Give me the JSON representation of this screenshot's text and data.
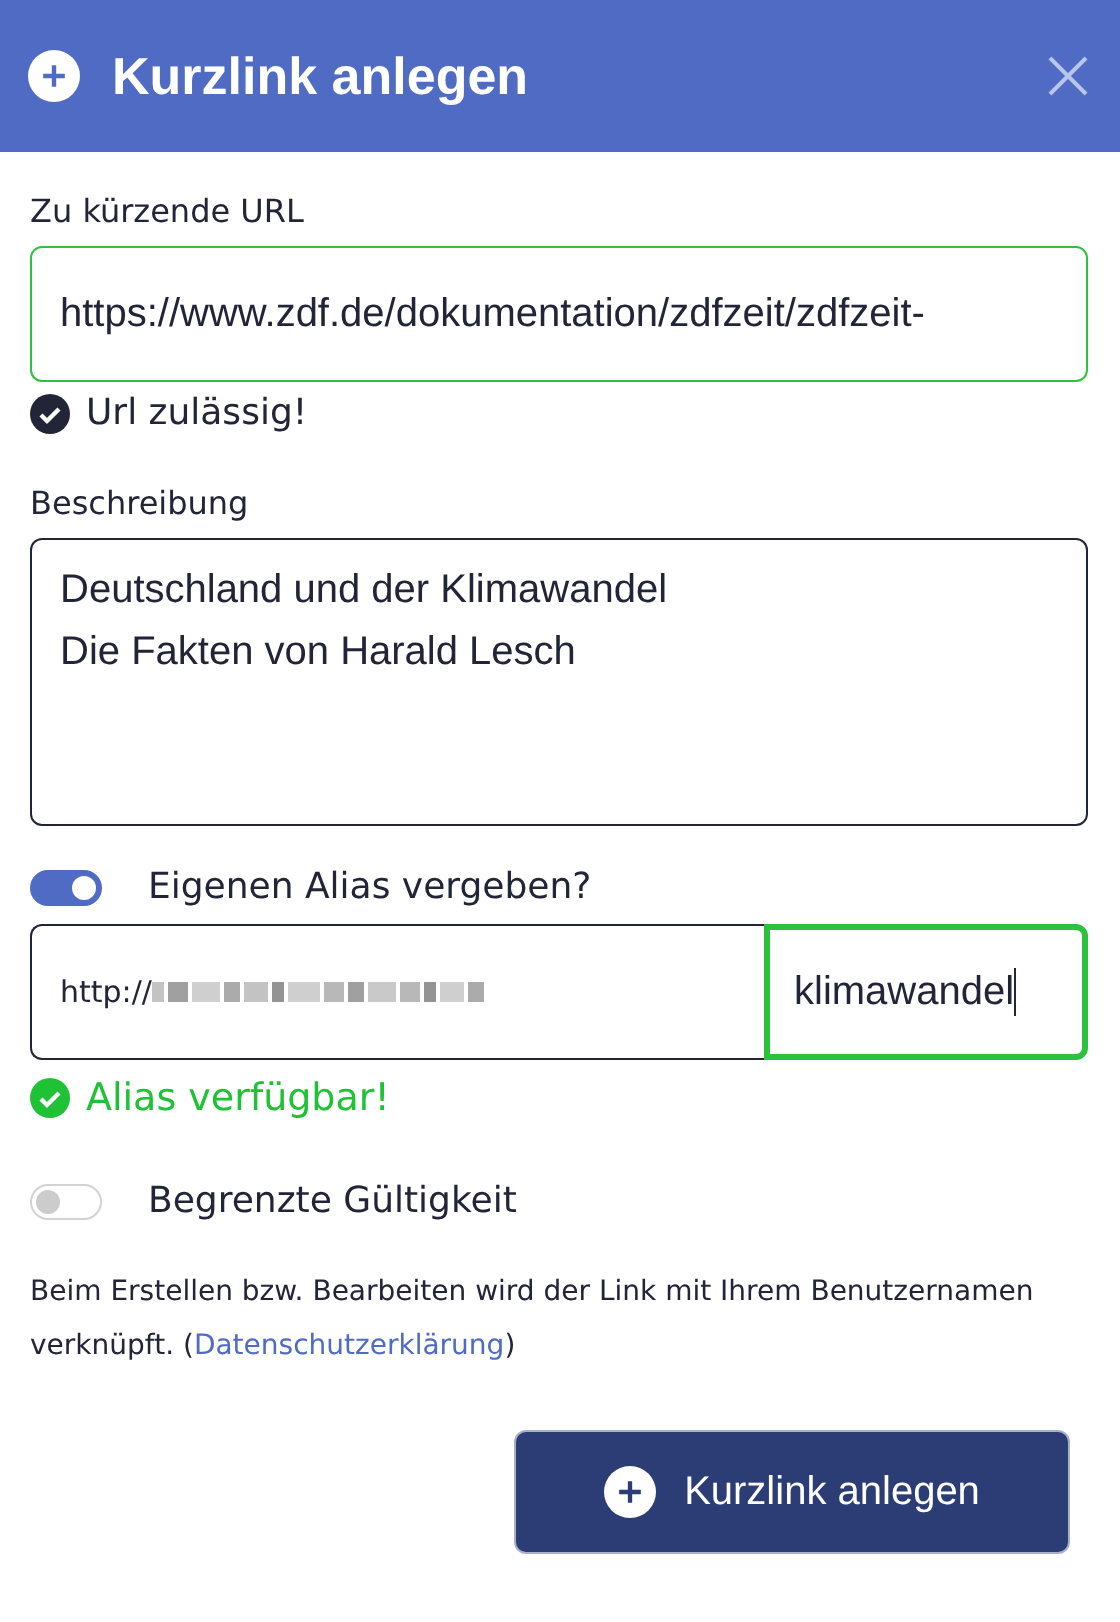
{
  "dialog": {
    "title": "Kurzlink anlegen"
  },
  "url_field": {
    "label": "Zu kürzende URL",
    "value": "https://www.zdf.de/dokumentation/zdfzeit/zdfzeit-",
    "valid": true,
    "message": "Url zulässig!"
  },
  "description_field": {
    "label": "Beschreibung",
    "value": "Deutschland und der Klimawandel\nDie Fakten von Harald Lesch"
  },
  "alias_toggle": {
    "label": "Eigenen Alias vergeben?",
    "on": true
  },
  "alias_field": {
    "prefix": "http://",
    "value": "klimawandel",
    "available": true,
    "message": "Alias verfügbar!"
  },
  "validity_toggle": {
    "label": "Begrenzte Gültigkeit",
    "on": false
  },
  "notice": {
    "text": "Beim Erstellen bzw. Bearbeiten wird der Link mit Ihrem Benutzernamen verknüpft. (",
    "link": "Datenschutzerklärung",
    "after": ")"
  },
  "submit_button": {
    "label": "Kurzlink anlegen"
  }
}
